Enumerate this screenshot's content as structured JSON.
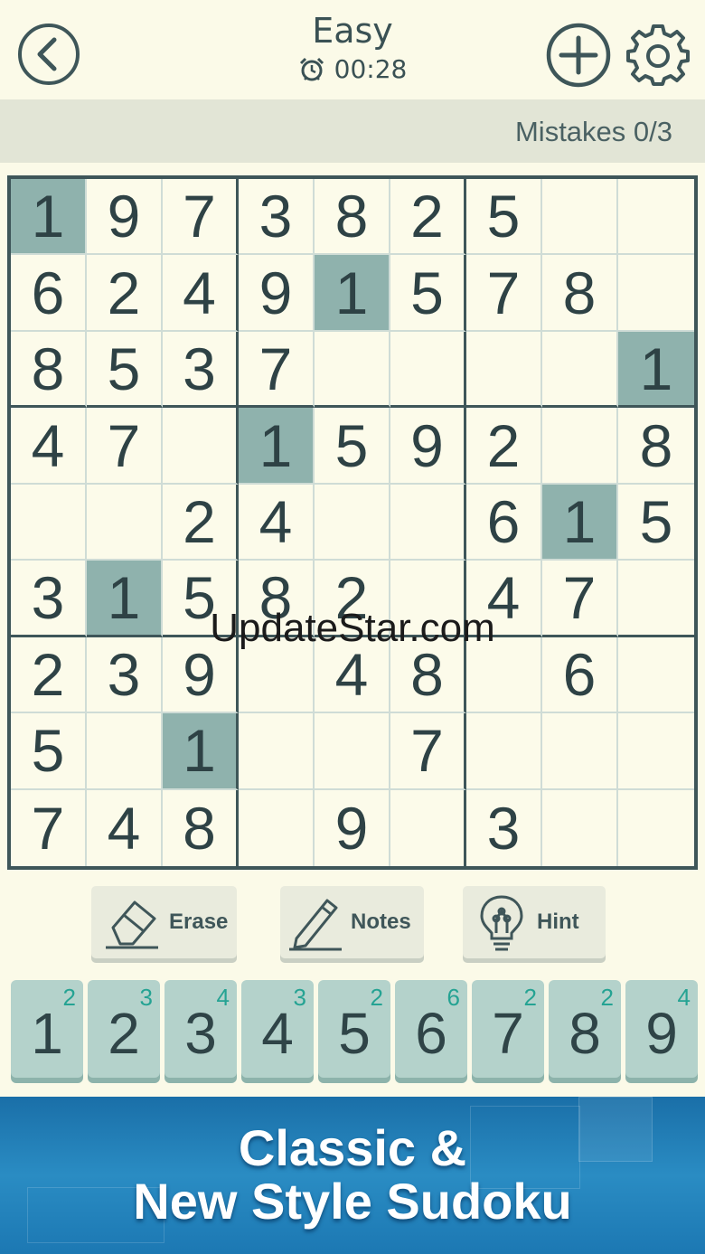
{
  "header": {
    "difficulty": "Easy",
    "timer": "00:28",
    "back_icon": "chevron-left-circle-icon",
    "add_icon": "plus-circle-icon",
    "settings_icon": "gear-icon",
    "timer_icon": "alarm-clock-icon"
  },
  "status": {
    "mistakes": "Mistakes 0/3"
  },
  "board": {
    "rows": [
      [
        "1",
        "9",
        "7",
        "3",
        "8",
        "2",
        "5",
        "",
        ""
      ],
      [
        "6",
        "2",
        "4",
        "9",
        "1",
        "5",
        "7",
        "8",
        ""
      ],
      [
        "8",
        "5",
        "3",
        "7",
        "",
        "",
        "",
        "",
        "1"
      ],
      [
        "4",
        "7",
        "",
        "1",
        "5",
        "9",
        "2",
        "",
        "8"
      ],
      [
        "",
        "",
        "2",
        "4",
        "",
        "",
        "6",
        "1",
        "5"
      ],
      [
        "3",
        "1",
        "5",
        "8",
        "2",
        "",
        "4",
        "7",
        ""
      ],
      [
        "2",
        "3",
        "9",
        "",
        "4",
        "8",
        "",
        "6",
        ""
      ],
      [
        "5",
        "",
        "1",
        "",
        "",
        "7",
        "",
        "",
        ""
      ],
      [
        "7",
        "4",
        "8",
        "",
        "9",
        "",
        "3",
        "",
        ""
      ]
    ],
    "highlighted_digit": "1",
    "highlight_color": "#8fb2ad"
  },
  "watermark": "UpdateStar.com",
  "tools": {
    "erase": {
      "label": "Erase",
      "icon": "eraser-icon"
    },
    "notes": {
      "label": "Notes",
      "icon": "pencil-icon"
    },
    "hint": {
      "label": "Hint",
      "icon": "lightbulb-icon"
    }
  },
  "numpad": [
    {
      "digit": "1",
      "count": "2"
    },
    {
      "digit": "2",
      "count": "3"
    },
    {
      "digit": "3",
      "count": "4"
    },
    {
      "digit": "4",
      "count": "3"
    },
    {
      "digit": "5",
      "count": "2"
    },
    {
      "digit": "6",
      "count": "6"
    },
    {
      "digit": "7",
      "count": "2"
    },
    {
      "digit": "8",
      "count": "2"
    },
    {
      "digit": "9",
      "count": "4"
    }
  ],
  "banner": {
    "line1": "Classic &",
    "line2": "New Style Sudoku"
  },
  "colors": {
    "background": "#fbfae8",
    "grid_line": "#3e5659",
    "numpad_key": "#b4d2cb",
    "count_text": "#25a393",
    "banner": "#2a8cc3"
  }
}
